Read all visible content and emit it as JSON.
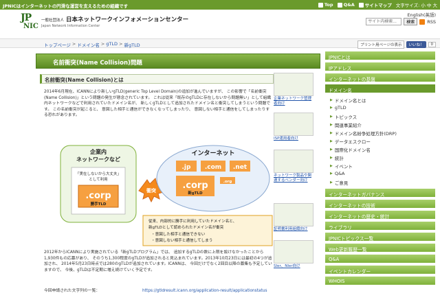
{
  "topbar": {
    "tagline": "JPNICはインターネットの円滑な運営を支えるための組織です",
    "nav": [
      {
        "label": "Top"
      },
      {
        "label": "Q&A"
      },
      {
        "label": "サイトマップ"
      },
      {
        "label": "文字サイズ: 小 中 大"
      }
    ]
  },
  "header": {
    "logo_jp": "JP",
    "logo_nic": "NIC",
    "org_prefix": "一般社団法人",
    "org_name": "日本ネットワークインフォメーションセンター",
    "org_name_en": "Japan Network Information Center",
    "english_label": "English(英語)",
    "search_placeholder": "サイト内検索...",
    "search_button": "検索",
    "rss_label": "RSS"
  },
  "breadcrumb": [
    "トップページ",
    "ドメイン名",
    "gTLD",
    "新gTLD"
  ],
  "toolbar": {
    "print": "プリント用ページの表示",
    "fb_like": "いいね！",
    "fb_count": "0"
  },
  "page_title": "名前衝突(Name Collision)問題",
  "section_title": "名前衝突(Name Collision)とは",
  "para1": "2014年6月現在、ICANNにより新しいgTLD(generic Top Level Domain)の追加が進んでいますが、 この影響で「名前衝突(Name Collision)」という問題の発生が懸念されています。 これは従来「既存のgTLDに存在しないから問題無い」として組織内ネットワークなどで利用されていたドメイン名が、 新しくgTLDとして追加されたドメイン名と衝突してしまうという問題です。 この名前衝突が起こると、 意図した相手と通信ができなくなってしまったり、 意図しない相手と通信をしてしまったりする恐れがあります。",
  "diagram": {
    "intranet_title": "企業内\nネットワークなど",
    "intranet_note": "「実在しないから大丈夫」\nとして利用",
    "corp_left": ".corp",
    "corp_left_label": "勝手TLD",
    "collision": "衝突",
    "internet_title": "インターネット",
    "tld_jp": ".jp",
    "tld_com": ".com",
    "tld_net": ".net",
    "tld_org": ".org",
    "corp_right": ".corp",
    "corp_right_label": "新gTLD",
    "note_line1": "従来、内部的に勝手に利用していたドメイン名と、",
    "note_line2": "新gTLDとして認められたドメイン名が衝突",
    "note_line3": "・意図した相手と通信できない",
    "note_line4": "・意図しない相手と通信してしまう"
  },
  "para2": "2012年からICANNにより実施されている「新gTLDプログラム」では、 追加するgTLDの数に上限を設けなかったことから1,930件もの応募があり、 そのうち1,300程度のgTLDが追加されると見込まれています。2013年10月23日には最初の4つが追加され、 2014年5月23日時点では280のgTLDが追加されています。ICANNは、 今回だけでなく2回目以降の募集も予定していますので、 今後、gTLDは不定期に増え続けていく予定です。",
  "para3_label": "今回申請された文字列の一覧：",
  "para3_link": "https://gtldresult.icann.org/application-result/applicationstatus",
  "promos": [
    "企業ネットワーク管理者向け",
    "ISP運用者向け",
    "ネットワーク製品や関連するベンダー向け",
    "証明書利用組織向け",
    "SIer、NIer向け"
  ],
  "sidebar": {
    "items": [
      {
        "label": "JPNICとは"
      },
      {
        "label": "IPアドレス"
      },
      {
        "label": "インターネットの基盤"
      },
      {
        "label": "ドメイン名"
      }
    ],
    "subitems": [
      "ドメイン名とは",
      "gTLD",
      "トピックス",
      "関連事業紹介",
      "ドメイン名紛争処理方針(DRP)",
      "データエスクロー",
      "国際化ドメイン名",
      "統計",
      "イベント",
      "Q&A",
      "ご意見"
    ],
    "items2": [
      {
        "label": "インターネットガバナンス"
      },
      {
        "label": "インターネットの技術"
      },
      {
        "label": "インターネットの歴史・統計"
      },
      {
        "label": "ライブラリ"
      },
      {
        "label": "JPNICトピックス一覧"
      },
      {
        "label": "Web更新履歴一覧"
      },
      {
        "label": "Q&A"
      },
      {
        "label": "イベントカレンダー"
      },
      {
        "label": "WHOIS"
      }
    ]
  }
}
